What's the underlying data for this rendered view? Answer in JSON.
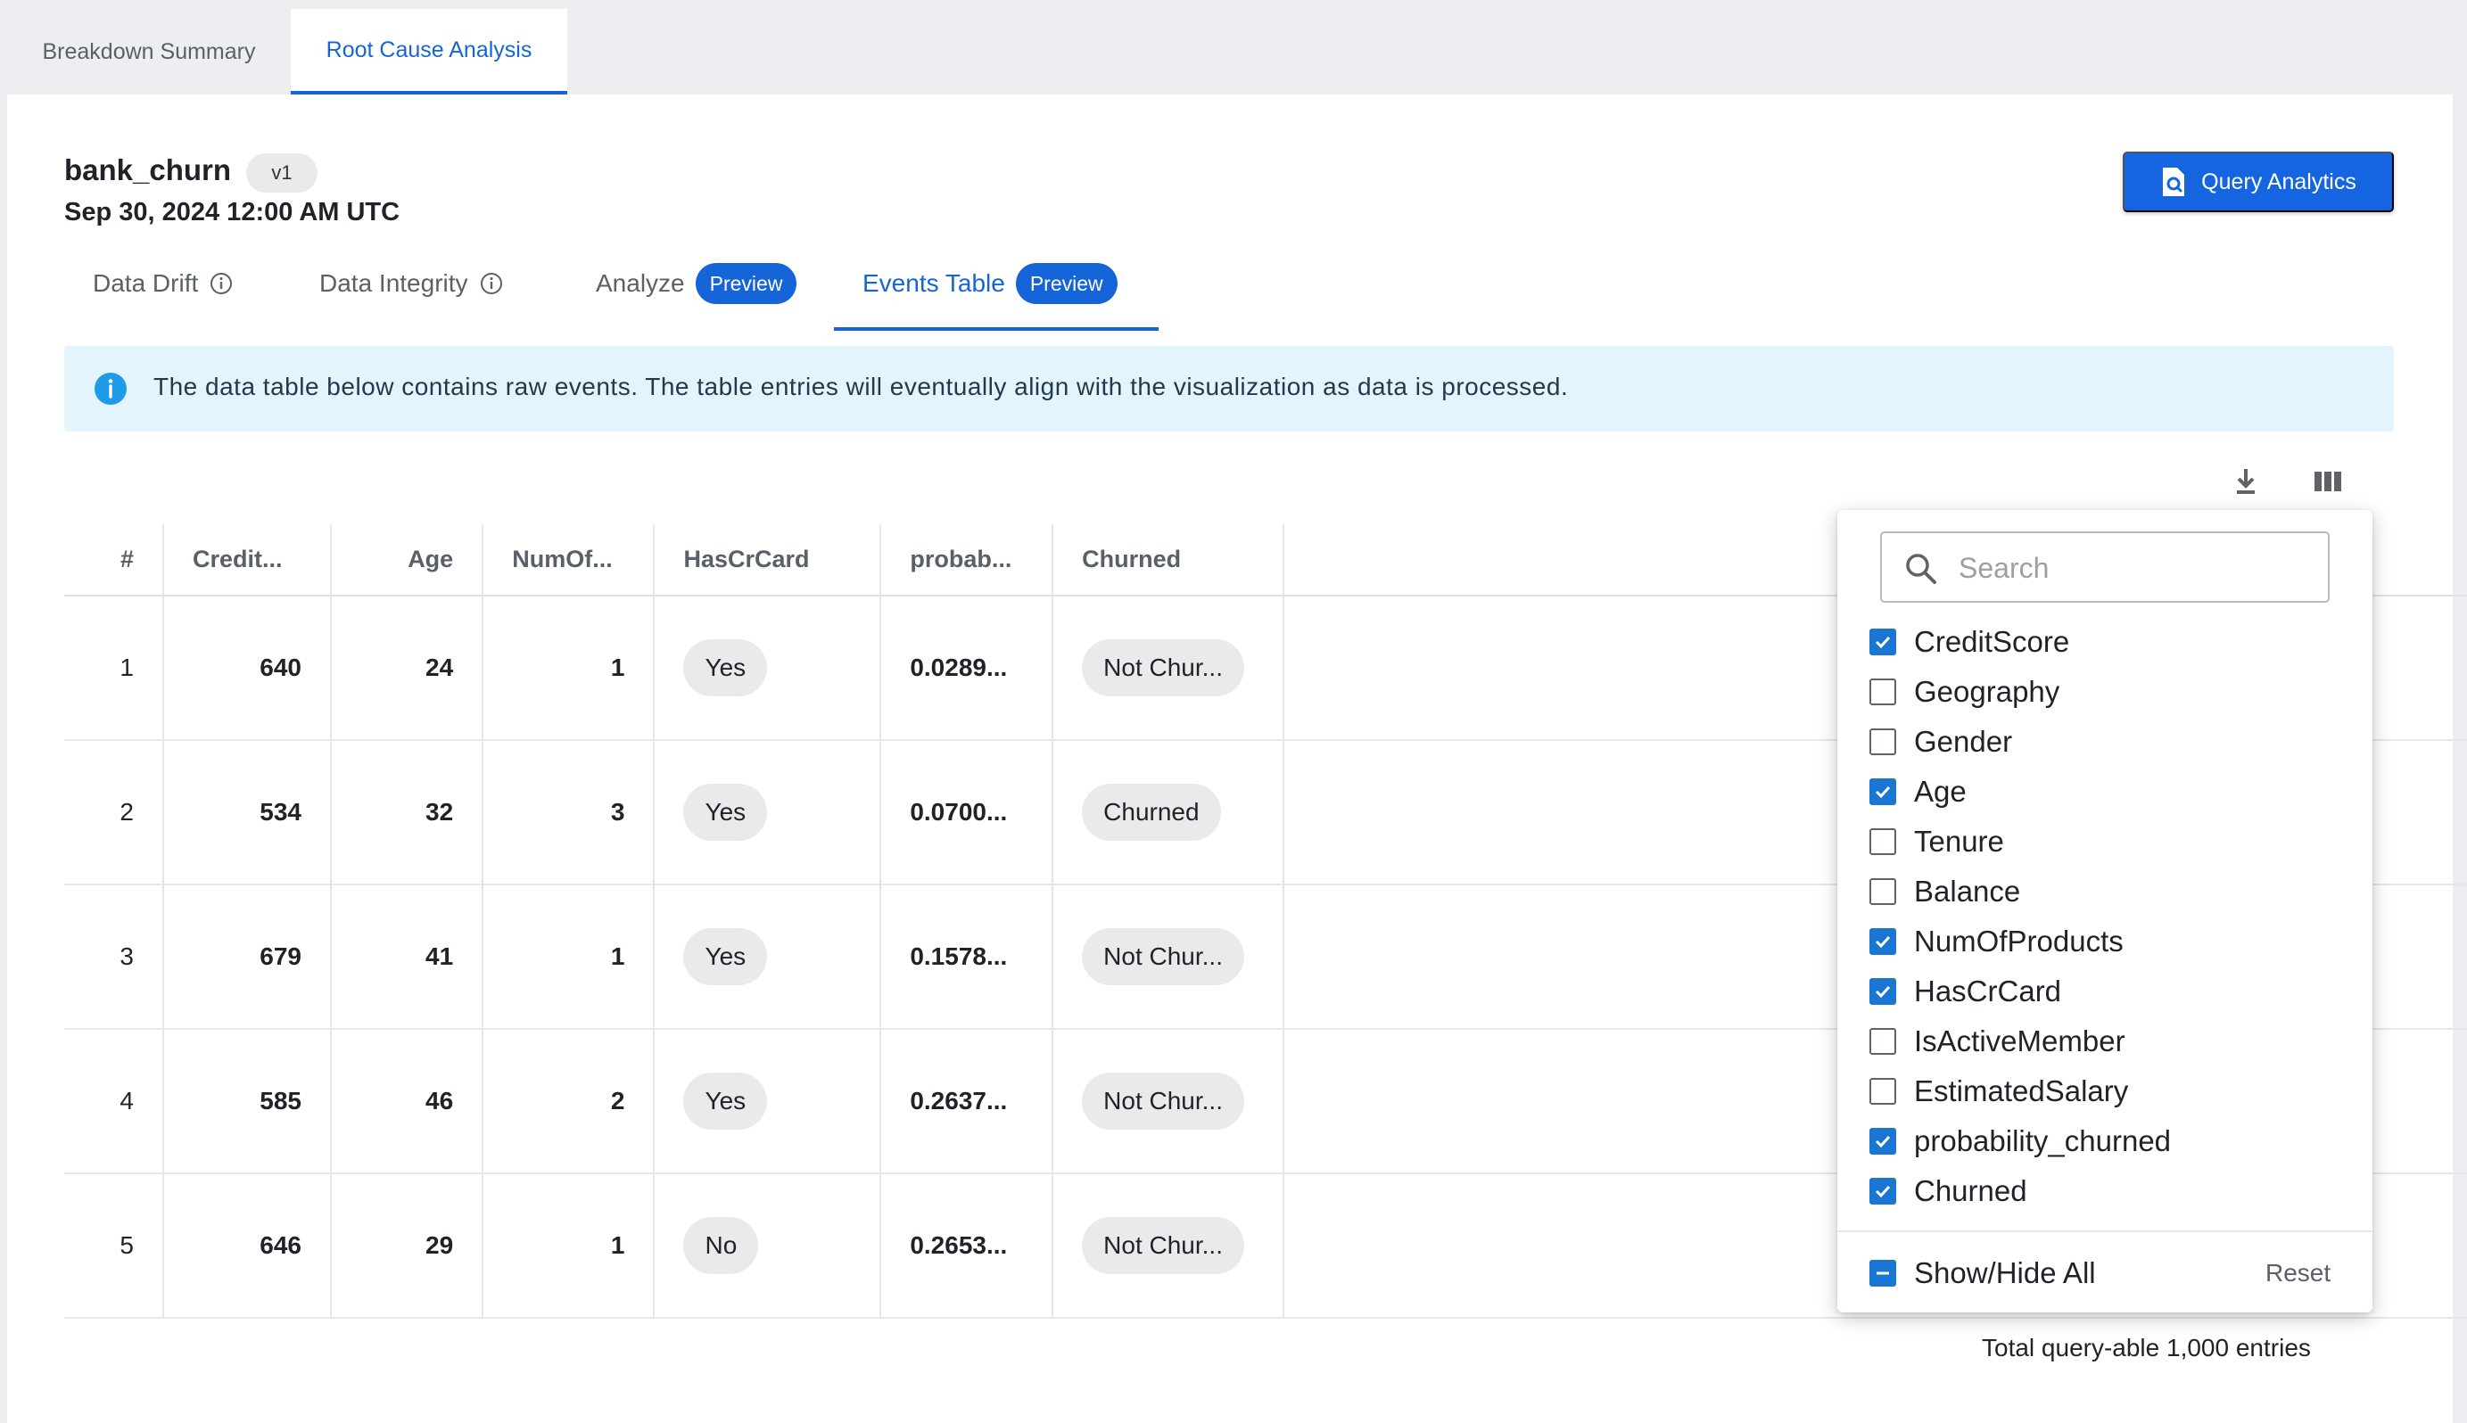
{
  "top_tabs": [
    {
      "label": "Breakdown Summary"
    },
    {
      "label": "Root Cause Analysis"
    }
  ],
  "model": {
    "name": "bank_churn",
    "version": "v1",
    "date": "Sep 30, 2024 12:00 AM UTC"
  },
  "query_button": {
    "label": "Query Analytics"
  },
  "sub_tabs": [
    {
      "label": "Data Drift"
    },
    {
      "label": "Data Integrity"
    },
    {
      "label": "Analyze",
      "badge": "Preview"
    },
    {
      "label": "Events Table",
      "badge": "Preview"
    }
  ],
  "banner": {
    "text": "The data table below contains raw events. The table entries will eventually align with the visualization as data is processed."
  },
  "table": {
    "headers": [
      "#",
      "Credit...",
      "Age",
      "NumOf...",
      "HasCrCard",
      "probab...",
      "Churned"
    ],
    "rows": [
      [
        "1",
        "640",
        "24",
        "1",
        "Yes",
        "0.0289...",
        "Not Chur..."
      ],
      [
        "2",
        "534",
        "32",
        "3",
        "Yes",
        "0.0700...",
        "Churned"
      ],
      [
        "3",
        "679",
        "41",
        "1",
        "Yes",
        "0.1578...",
        "Not Chur..."
      ],
      [
        "4",
        "585",
        "46",
        "2",
        "Yes",
        "0.2637...",
        "Not Chur..."
      ],
      [
        "5",
        "646",
        "29",
        "1",
        "No",
        "0.2653...",
        "Not Chur..."
      ]
    ]
  },
  "footer": {
    "total": "Total query-able 1,000 entries"
  },
  "column_menu": {
    "search_placeholder": "Search",
    "columns": [
      {
        "label": "CreditScore",
        "checked": true
      },
      {
        "label": "Geography",
        "checked": false
      },
      {
        "label": "Gender",
        "checked": false
      },
      {
        "label": "Age",
        "checked": true
      },
      {
        "label": "Tenure",
        "checked": false
      },
      {
        "label": "Balance",
        "checked": false
      },
      {
        "label": "NumOfProducts",
        "checked": true
      },
      {
        "label": "HasCrCard",
        "checked": true
      },
      {
        "label": "IsActiveMember",
        "checked": false
      },
      {
        "label": "EstimatedSalary",
        "checked": false
      },
      {
        "label": "probability_churned",
        "checked": true
      },
      {
        "label": "Churned",
        "checked": true
      }
    ],
    "show_hide_all": "Show/Hide All",
    "reset": "Reset"
  },
  "colors": {
    "accent": "#1565d8",
    "banner_bg": "#e4f4fc",
    "checkbox": "#1976d2"
  },
  "icons": [
    "document-search-icon",
    "info-icon",
    "download-icon",
    "columns-icon",
    "search-icon",
    "check-icon",
    "indeterminate-icon"
  ]
}
